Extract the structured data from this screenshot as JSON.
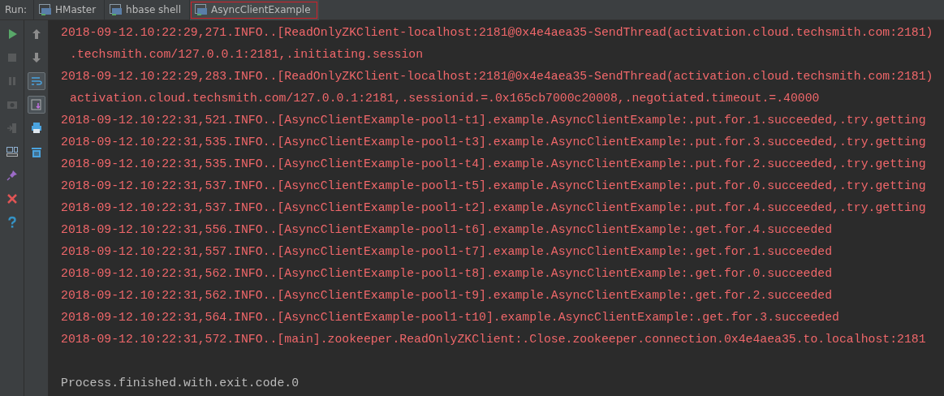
{
  "run_label": "Run:",
  "tabs": [
    {
      "label": "HMaster",
      "selected": false
    },
    {
      "label": "hbase shell",
      "selected": false
    },
    {
      "label": "AsyncClientExample",
      "selected": true
    }
  ],
  "left_toolbar": [
    {
      "kind": "run",
      "disabled": false
    },
    {
      "kind": "stop",
      "disabled": true
    },
    {
      "kind": "pause",
      "disabled": true
    },
    {
      "kind": "dump",
      "disabled": true
    },
    {
      "kind": "exit",
      "disabled": true
    },
    {
      "kind": "layout",
      "disabled": false
    },
    {
      "kind": "pin",
      "disabled": false
    },
    {
      "kind": "close",
      "disabled": false
    },
    {
      "kind": "help",
      "disabled": false
    }
  ],
  "right_toolbar": [
    {
      "kind": "up",
      "toggled": false
    },
    {
      "kind": "down",
      "toggled": false
    },
    {
      "kind": "wrap",
      "toggled": true
    },
    {
      "kind": "scroll",
      "toggled": true
    },
    {
      "kind": "print",
      "toggled": false
    },
    {
      "kind": "trash",
      "toggled": false
    }
  ],
  "console_lines": [
    {
      "text": "2018-09-12.10:22:29,271.INFO..[ReadOnlyZKClient-localhost:2181@0x4e4aea35-SendThread(activation.cloud.techsmith.com:2181)",
      "wrapped": false,
      "kind": "error"
    },
    {
      "text": ".techsmith.com/127.0.0.1:2181,.initiating.session",
      "wrapped": true,
      "kind": "error"
    },
    {
      "text": "2018-09-12.10:22:29,283.INFO..[ReadOnlyZKClient-localhost:2181@0x4e4aea35-SendThread(activation.cloud.techsmith.com:2181)",
      "wrapped": false,
      "kind": "error"
    },
    {
      "text": "activation.cloud.techsmith.com/127.0.0.1:2181,.sessionid.=.0x165cb7000c20008,.negotiated.timeout.=.40000",
      "wrapped": true,
      "kind": "error"
    },
    {
      "text": "2018-09-12.10:22:31,521.INFO..[AsyncClientExample-pool1-t1].example.AsyncClientExample:.put.for.1.succeeded,.try.getting",
      "wrapped": false,
      "kind": "error"
    },
    {
      "text": "2018-09-12.10:22:31,535.INFO..[AsyncClientExample-pool1-t3].example.AsyncClientExample:.put.for.3.succeeded,.try.getting",
      "wrapped": false,
      "kind": "error"
    },
    {
      "text": "2018-09-12.10:22:31,535.INFO..[AsyncClientExample-pool1-t4].example.AsyncClientExample:.put.for.2.succeeded,.try.getting",
      "wrapped": false,
      "kind": "error"
    },
    {
      "text": "2018-09-12.10:22:31,537.INFO..[AsyncClientExample-pool1-t5].example.AsyncClientExample:.put.for.0.succeeded,.try.getting",
      "wrapped": false,
      "kind": "error"
    },
    {
      "text": "2018-09-12.10:22:31,537.INFO..[AsyncClientExample-pool1-t2].example.AsyncClientExample:.put.for.4.succeeded,.try.getting",
      "wrapped": false,
      "kind": "error"
    },
    {
      "text": "2018-09-12.10:22:31,556.INFO..[AsyncClientExample-pool1-t6].example.AsyncClientExample:.get.for.4.succeeded",
      "wrapped": false,
      "kind": "error"
    },
    {
      "text": "2018-09-12.10:22:31,557.INFO..[AsyncClientExample-pool1-t7].example.AsyncClientExample:.get.for.1.succeeded",
      "wrapped": false,
      "kind": "error"
    },
    {
      "text": "2018-09-12.10:22:31,562.INFO..[AsyncClientExample-pool1-t8].example.AsyncClientExample:.get.for.0.succeeded",
      "wrapped": false,
      "kind": "error"
    },
    {
      "text": "2018-09-12.10:22:31,562.INFO..[AsyncClientExample-pool1-t9].example.AsyncClientExample:.get.for.2.succeeded",
      "wrapped": false,
      "kind": "error"
    },
    {
      "text": "2018-09-12.10:22:31,564.INFO..[AsyncClientExample-pool1-t10].example.AsyncClientExample:.get.for.3.succeeded",
      "wrapped": false,
      "kind": "error"
    },
    {
      "text": "2018-09-12.10:22:31,572.INFO..[main].zookeeper.ReadOnlyZKClient:.Close.zookeeper.connection.0x4e4aea35.to.localhost:2181",
      "wrapped": false,
      "kind": "error"
    },
    {
      "kind": "blank"
    },
    {
      "text": "Process.finished.with.exit.code.0",
      "wrapped": false,
      "kind": "system"
    }
  ]
}
